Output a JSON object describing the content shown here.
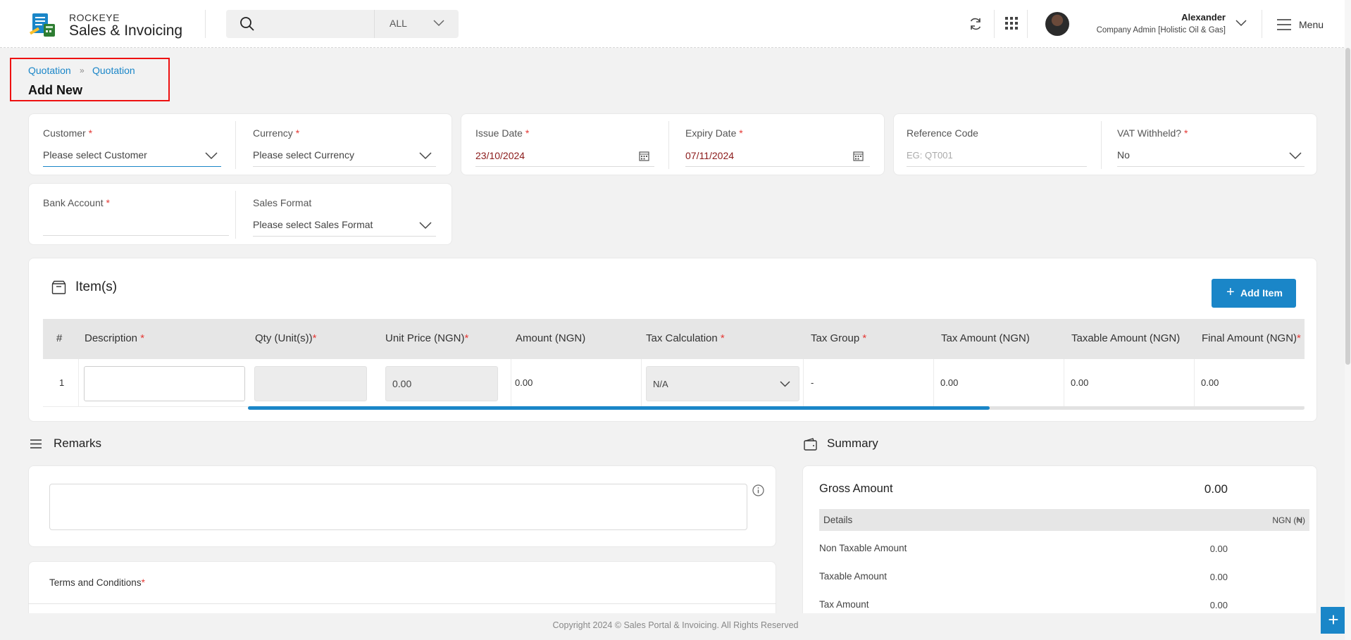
{
  "header": {
    "brand_top": "ROCKEYE",
    "brand_main": "Sales & Invoicing",
    "search_placeholder": "",
    "search_scope": "ALL",
    "user_name": "Alexander",
    "user_role": "Company Admin [Holistic Oil & Gas]",
    "menu_label": "Menu"
  },
  "breadcrumb": {
    "items": [
      "Quotation",
      "Quotation"
    ],
    "page_title": "Add New"
  },
  "form": {
    "customer": {
      "label": "Customer",
      "value": "Please select Customer"
    },
    "currency": {
      "label": "Currency",
      "value": "Please select Currency"
    },
    "issue_date": {
      "label": "Issue Date",
      "value": "23/10/2024"
    },
    "expiry_date": {
      "label": "Expiry Date",
      "value": "07/11/2024"
    },
    "reference_code": {
      "label": "Reference Code",
      "placeholder": "EG: QT001"
    },
    "vat_withheld": {
      "label": "VAT Withheld?",
      "value": "No"
    },
    "bank_account": {
      "label": "Bank Account",
      "value": ""
    },
    "sales_format": {
      "label": "Sales Format",
      "value": "Please select Sales Format"
    }
  },
  "items": {
    "title": "Item(s)",
    "add_button": "Add Item",
    "columns": [
      "#",
      "Description",
      "Qty (Unit(s))",
      "Unit Price (NGN)",
      "Amount (NGN)",
      "Tax Calculation",
      "Tax Group",
      "Tax Amount (NGN)",
      "Taxable Amount (NGN)",
      "Final Amount (NGN)"
    ],
    "row": {
      "index": "1",
      "unit_price": "0.00",
      "amount": "0.00",
      "tax_calculation": "N/A",
      "tax_group": "-",
      "tax_amount": "0.00",
      "taxable_amount": "0.00",
      "final_amount": "0.00"
    }
  },
  "remarks": {
    "title": "Remarks"
  },
  "terms": {
    "label": "Terms and Conditions"
  },
  "summary": {
    "title": "Summary",
    "gross_label": "Gross Amount",
    "gross_value": "0.00",
    "details_label": "Details",
    "details_currency": "NGN (₦)",
    "rows": [
      {
        "label": "Non Taxable Amount",
        "value": "0.00"
      },
      {
        "label": "Taxable Amount",
        "value": "0.00"
      },
      {
        "label": "Tax Amount",
        "value": "0.00"
      }
    ]
  },
  "footer": {
    "copyright": "Copyright 2024 © Sales Portal & Invoicing. All Rights Reserved"
  },
  "colors": {
    "accent": "#1a86c8",
    "required": "#e53935",
    "date_text": "#8b1a1a"
  }
}
